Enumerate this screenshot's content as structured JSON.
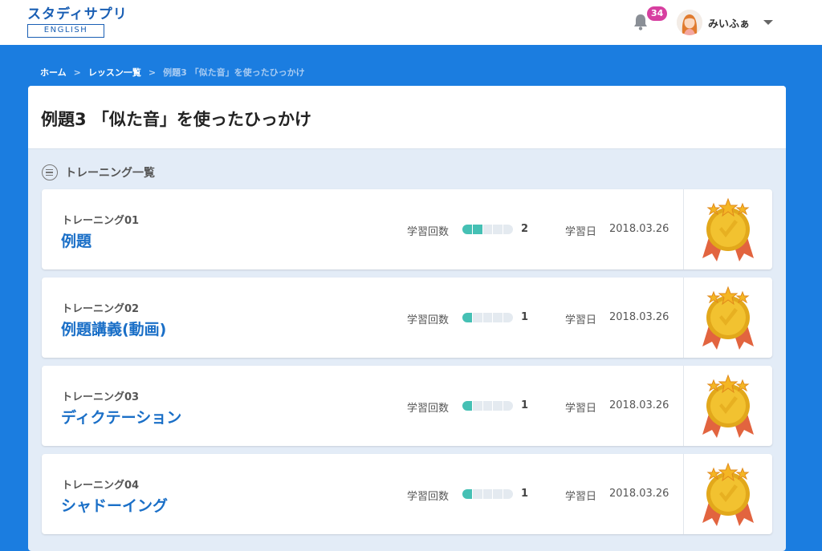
{
  "header": {
    "logo_text": "スタディサプリ",
    "logo_sub": "ENGLISH",
    "notification_count": "34",
    "username": "みいふぁ",
    "icons": [
      "bell-icon",
      "avatar",
      "chevron-down-icon"
    ]
  },
  "breadcrumb": {
    "home": "ホーム",
    "lessons": "レッスン一覧",
    "current": "例題3 「似た音」を使ったひっかけ",
    "separator": ">"
  },
  "page": {
    "title": "例題3 「似た音」を使ったひっかけ",
    "list_title": "トレーニング一覧"
  },
  "trainings": [
    {
      "label": "トレーニング01",
      "title": "例題",
      "count_label": "学習回数",
      "count": "2",
      "progress": 0.4,
      "date_label": "学習日",
      "date": "2018.03.26"
    },
    {
      "label": "トレーニング02",
      "title": "例題講義(動画)",
      "count_label": "学習回数",
      "count": "1",
      "progress": 0.2,
      "date_label": "学習日",
      "date": "2018.03.26"
    },
    {
      "label": "トレーニング03",
      "title": "ディクテーション",
      "count_label": "学習回数",
      "count": "1",
      "progress": 0.2,
      "date_label": "学習日",
      "date": "2018.03.26"
    },
    {
      "label": "トレーニング04",
      "title": "シャドーイング",
      "count_label": "学習回数",
      "count": "1",
      "progress": 0.2,
      "date_label": "学習日",
      "date": "2018.03.26"
    }
  ],
  "colors": {
    "background": "#1b7de0",
    "accent": "#1a6fc7",
    "progress": "#45c0b4",
    "badge": "#d73fa0",
    "medal_gold": "#f2c230",
    "medal_ribbon": "#e2643f"
  }
}
